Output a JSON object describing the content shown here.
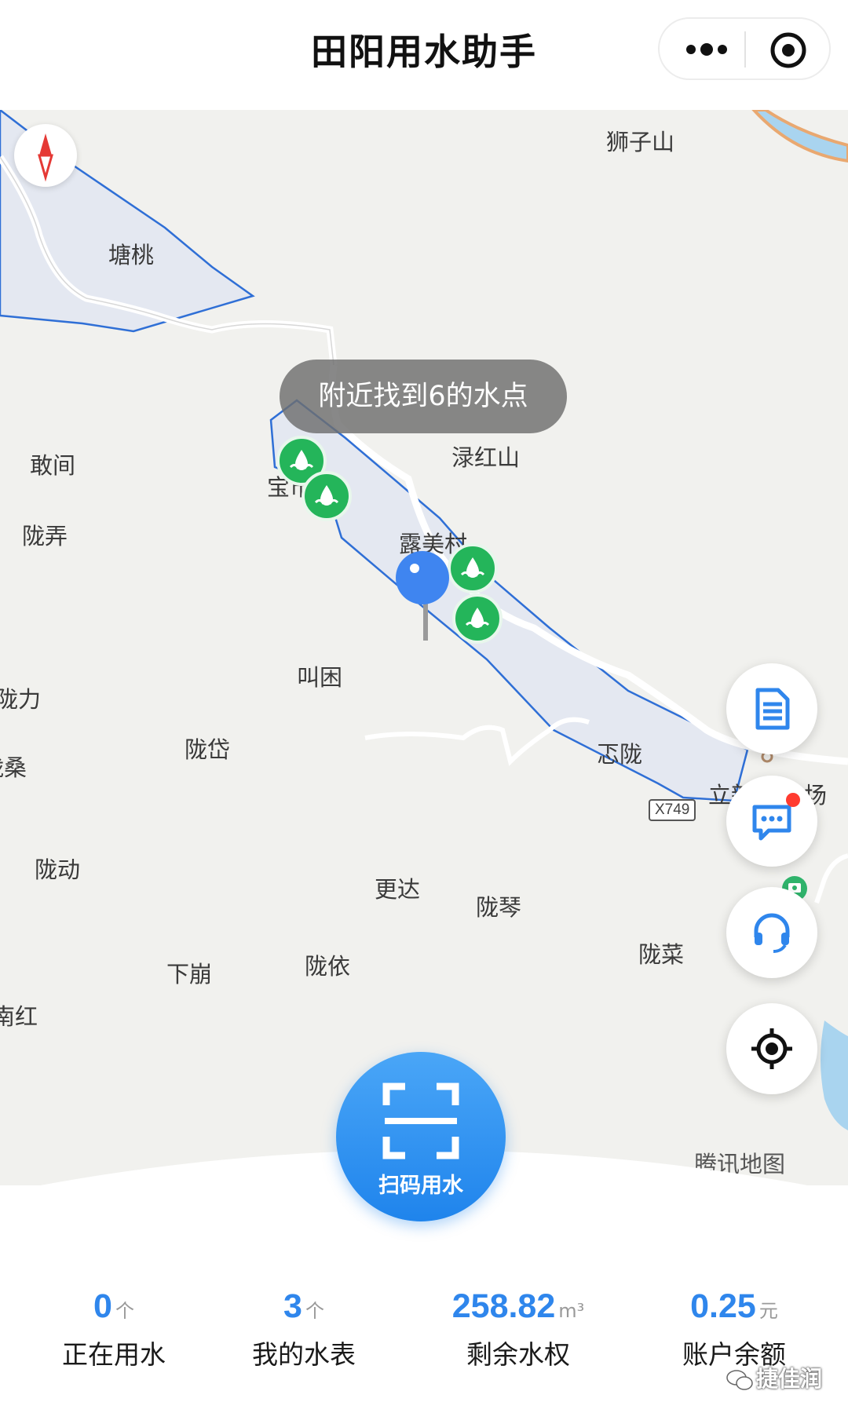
{
  "header": {
    "title": "田阳用水助手"
  },
  "map": {
    "toast": "附近找到6的水点",
    "road_badge": "X749",
    "attribution": "腾讯地图",
    "places": [
      {
        "name": "狮子山"
      },
      {
        "name": "塘桃"
      },
      {
        "name": "敢间"
      },
      {
        "name": "陇弄"
      },
      {
        "name": "宝市屯"
      },
      {
        "name": "渌红山"
      },
      {
        "name": "露美村"
      },
      {
        "name": "叫困"
      },
      {
        "name": "陇力"
      },
      {
        "name": "陇岱"
      },
      {
        "name": "陇桑"
      },
      {
        "name": "忑陇"
      },
      {
        "name": "立新"
      },
      {
        "name": "场"
      },
      {
        "name": "陇动"
      },
      {
        "name": "更达"
      },
      {
        "name": "陇琴"
      },
      {
        "name": "陇菜"
      },
      {
        "name": "下崩"
      },
      {
        "name": "陇依"
      },
      {
        "name": "南红"
      }
    ],
    "fab_icons": [
      "document-icon",
      "message-icon",
      "headset-icon",
      "locate-icon"
    ]
  },
  "scan": {
    "label": "扫码用水"
  },
  "stats": [
    {
      "value": "0",
      "unit": "个",
      "label": "正在用水"
    },
    {
      "value": "3",
      "unit": "个",
      "label": "我的水表"
    },
    {
      "value": "258.82",
      "unit": "m³",
      "label": "剩余水权"
    },
    {
      "value": "0.25",
      "unit": "元",
      "label": "账户余额"
    }
  ],
  "watermark": "捷佳润",
  "colors": {
    "primary": "#2f86ec",
    "water_marker": "#24b55a",
    "region_border": "#2f6fd6",
    "region_fill": "#e4e8f1"
  }
}
